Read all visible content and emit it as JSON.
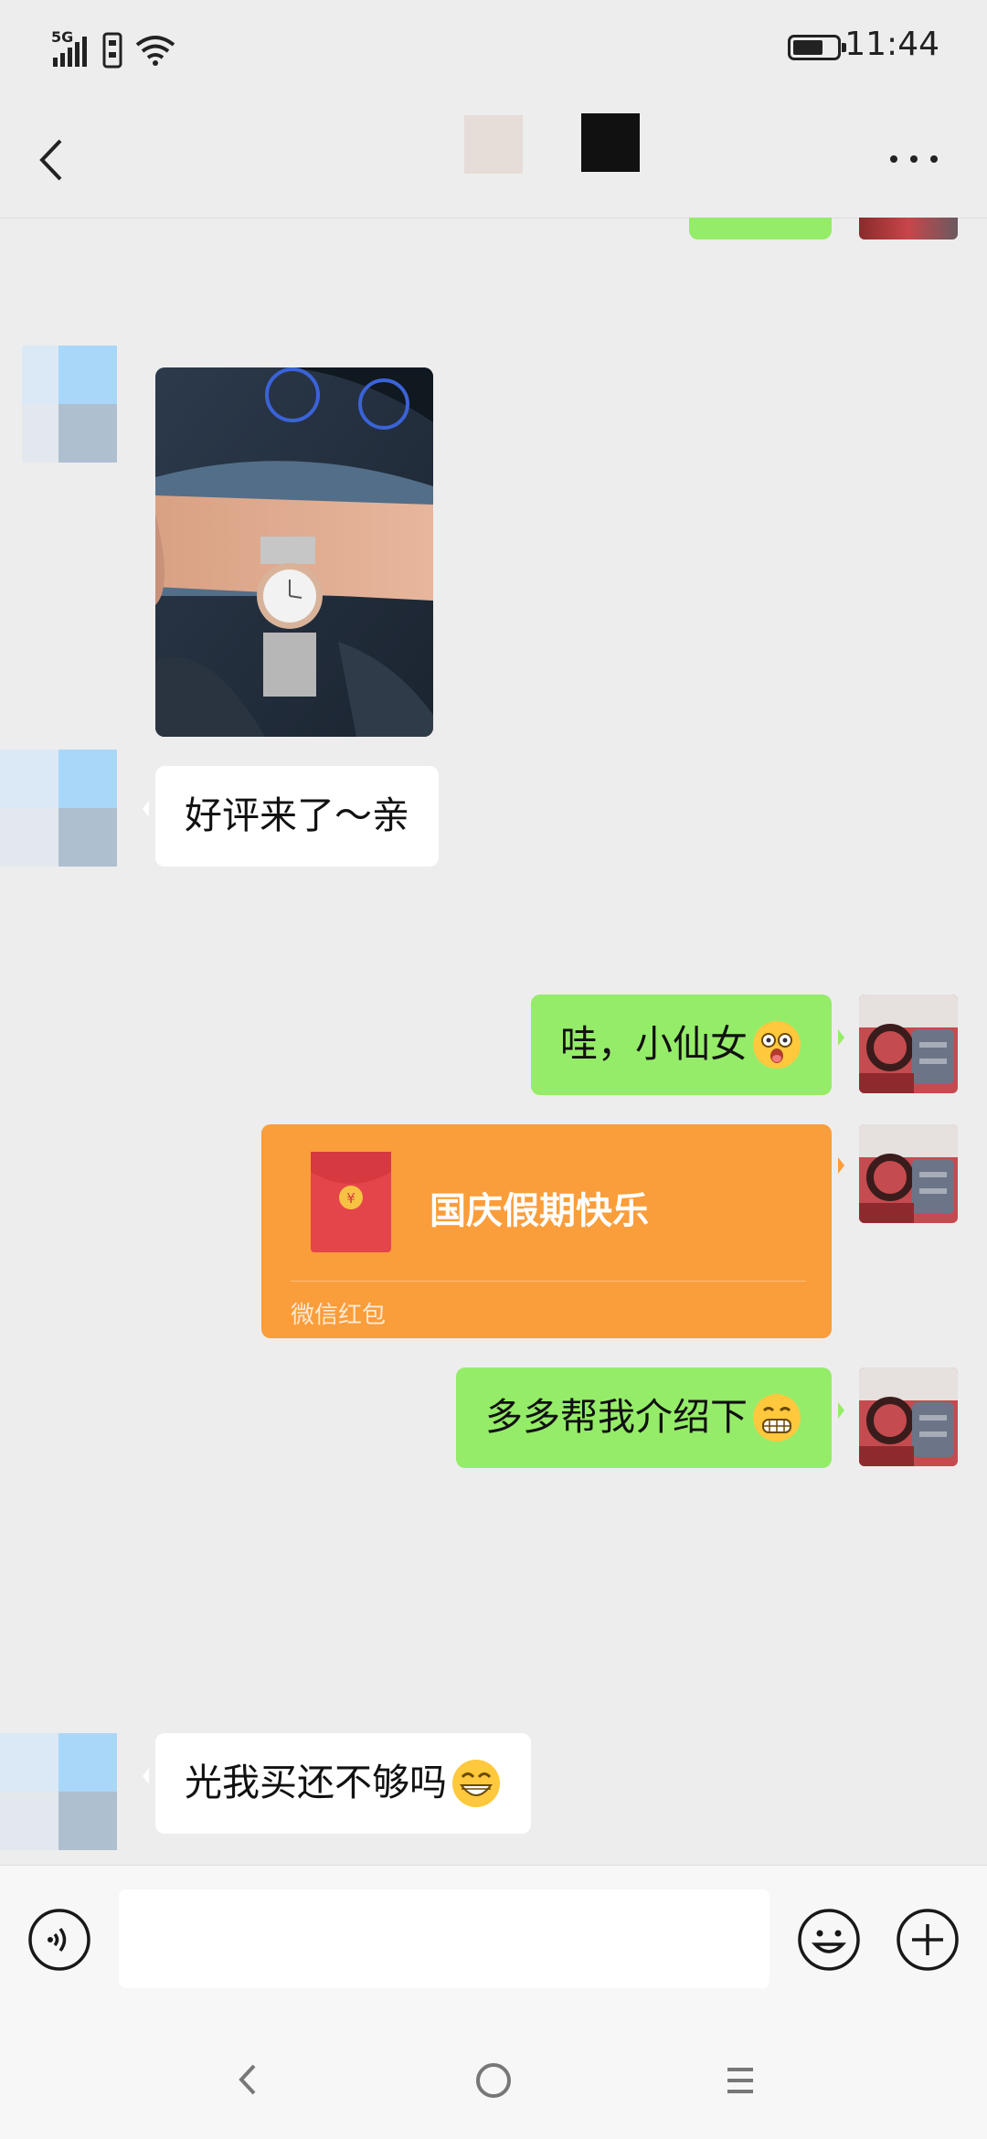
{
  "status_bar": {
    "network": "5G",
    "time": "11:44",
    "battery_level": 0.7
  },
  "header": {
    "back_icon": "back-arrow-icon",
    "more_icon": "more-dots-icon"
  },
  "messages": [
    {
      "id": "m1",
      "side": "left",
      "type": "image",
      "description_icon": "watch-photo"
    },
    {
      "id": "m2",
      "side": "left",
      "type": "text",
      "text": "好评来了～亲"
    },
    {
      "id": "m3",
      "side": "right",
      "type": "text",
      "text": "哇，小仙女",
      "emoji": "surprised-emoji"
    },
    {
      "id": "m4",
      "side": "right",
      "type": "red_packet",
      "title": "国庆假期快乐",
      "footer": "微信红包"
    },
    {
      "id": "m5",
      "side": "right",
      "type": "text",
      "text": "多多帮我介绍下",
      "emoji": "grimace-emoji"
    },
    {
      "id": "m6",
      "side": "left",
      "type": "text",
      "text": "光我买还不够吗",
      "emoji": "grin-emoji"
    }
  ],
  "input_bar": {
    "voice_icon": "voice-icon",
    "emoji_icon": "emoji-icon",
    "plus_icon": "plus-icon",
    "input_value": ""
  },
  "nav_bar": {
    "back": "nav-back-icon",
    "home": "nav-home-icon",
    "menu": "nav-menu-icon"
  },
  "colors": {
    "background": "#ededed",
    "green_bubble": "#95ec69",
    "red_packet": "#fa9d3b"
  }
}
